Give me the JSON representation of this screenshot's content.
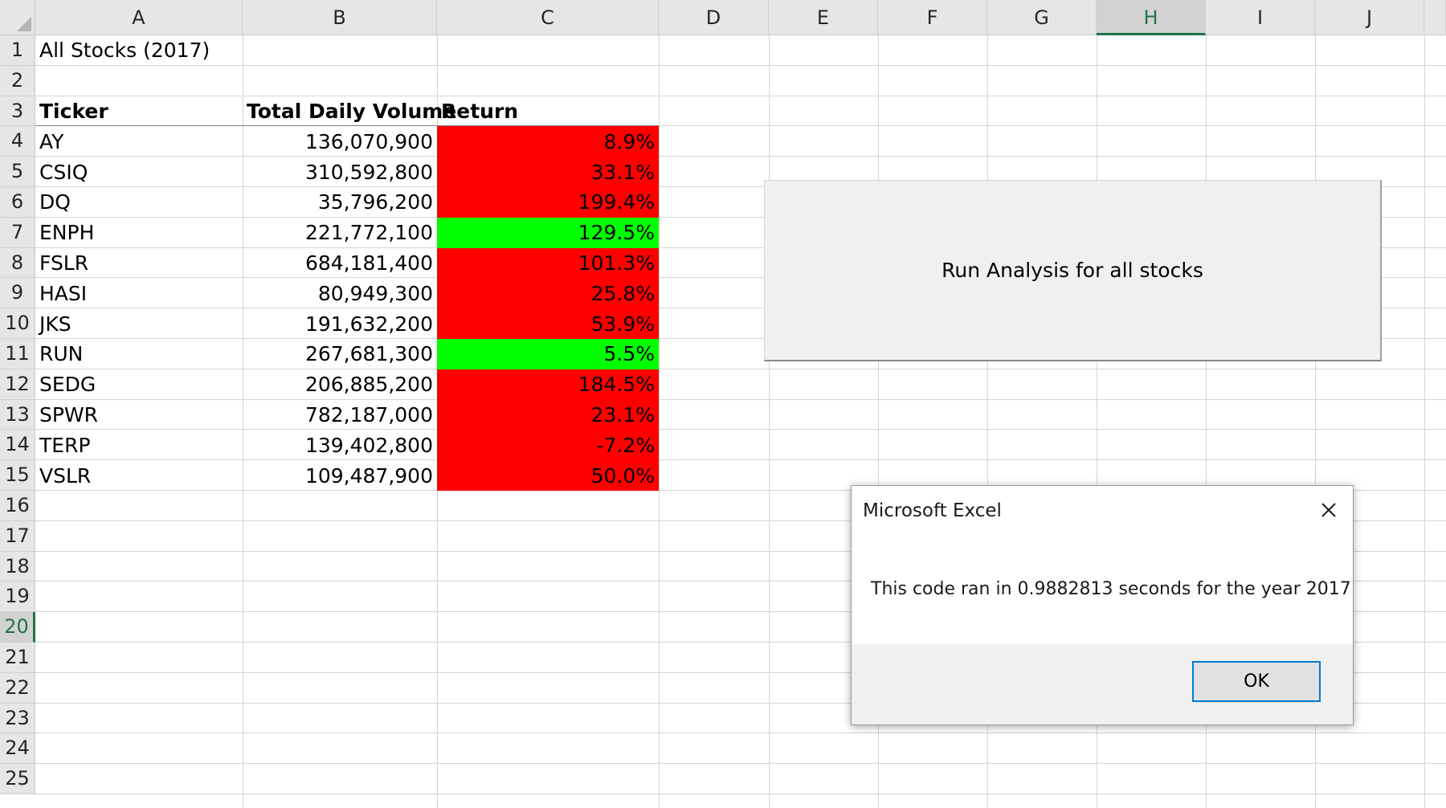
{
  "columns": [
    "A",
    "B",
    "C",
    "D",
    "E",
    "F",
    "G",
    "H",
    "I",
    "J"
  ],
  "rows": [
    "1",
    "2",
    "3",
    "4",
    "5",
    "6",
    "7",
    "8",
    "9",
    "10",
    "11",
    "12",
    "13",
    "14",
    "15",
    "16",
    "17",
    "18",
    "19",
    "20",
    "21",
    "22",
    "23",
    "24",
    "25"
  ],
  "selected": {
    "column": "H",
    "row": "20"
  },
  "sheet": {
    "title": "All Stocks (2017)",
    "headers": {
      "ticker": "Ticker",
      "volume": "Total Daily Volume",
      "return": "Return"
    },
    "stocks": [
      {
        "ticker": "AY",
        "volume": "136,070,900",
        "return": "8.9%",
        "fill": "red"
      },
      {
        "ticker": "CSIQ",
        "volume": "310,592,800",
        "return": "33.1%",
        "fill": "red"
      },
      {
        "ticker": "DQ",
        "volume": "35,796,200",
        "return": "199.4%",
        "fill": "red"
      },
      {
        "ticker": "ENPH",
        "volume": "221,772,100",
        "return": "129.5%",
        "fill": "green"
      },
      {
        "ticker": "FSLR",
        "volume": "684,181,400",
        "return": "101.3%",
        "fill": "red"
      },
      {
        "ticker": "HASI",
        "volume": "80,949,300",
        "return": "25.8%",
        "fill": "red"
      },
      {
        "ticker": "JKS",
        "volume": "191,632,200",
        "return": "53.9%",
        "fill": "red"
      },
      {
        "ticker": "RUN",
        "volume": "267,681,300",
        "return": "5.5%",
        "fill": "green"
      },
      {
        "ticker": "SEDG",
        "volume": "206,885,200",
        "return": "184.5%",
        "fill": "red"
      },
      {
        "ticker": "SPWR",
        "volume": "782,187,000",
        "return": "23.1%",
        "fill": "red"
      },
      {
        "ticker": "TERP",
        "volume": "139,402,800",
        "return": "-7.2%",
        "fill": "red"
      },
      {
        "ticker": "VSLR",
        "volume": "109,487,900",
        "return": "50.0%",
        "fill": "red"
      }
    ]
  },
  "colors": {
    "red_fill": "#ff0000",
    "green_fill": "#00ff00",
    "selection_accent": "#217346",
    "dialog_focus": "#0078d7"
  },
  "macro_button": {
    "label": "Run Analysis for all stocks"
  },
  "dialog": {
    "title": "Microsoft Excel",
    "message": "This code ran in 0.9882813 seconds for the year 2017",
    "ok_label": "OK",
    "close_icon": "close-icon"
  }
}
